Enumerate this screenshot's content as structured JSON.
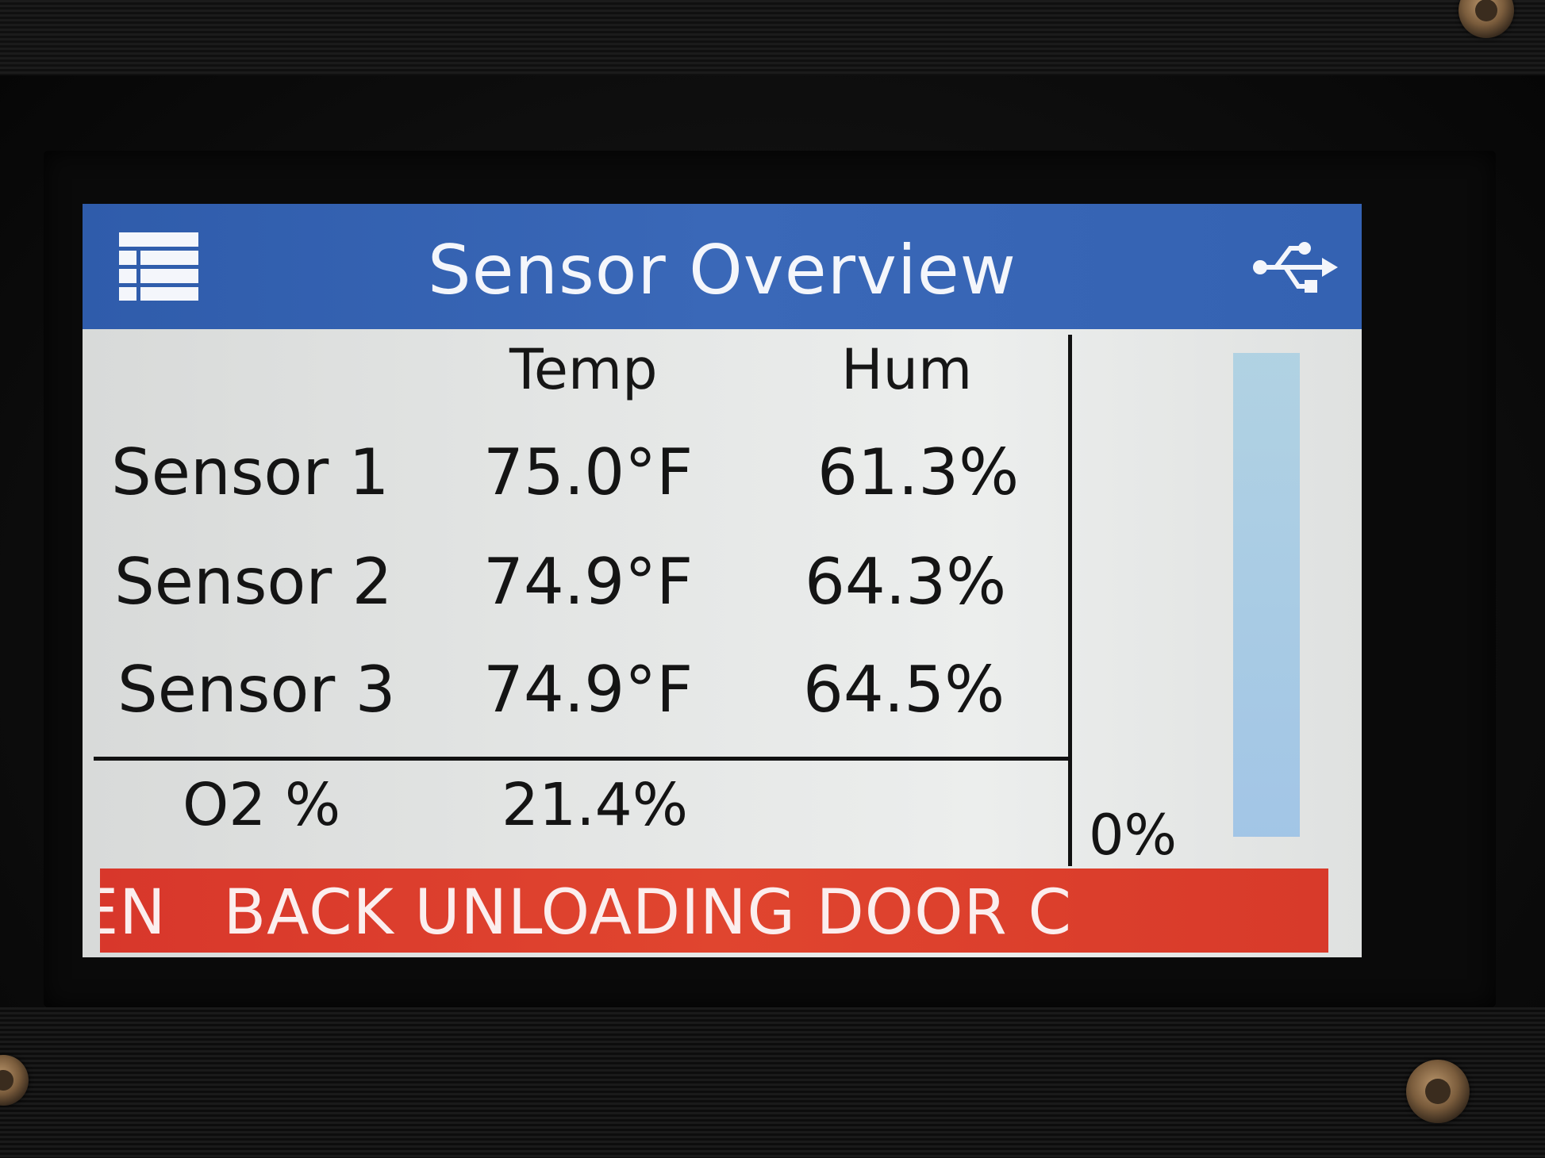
{
  "header": {
    "title": "Sensor Overview",
    "menu_icon": "menu-grid-icon",
    "status_icon": "usb-icon",
    "color": "#3462b2"
  },
  "table": {
    "columns": [
      "Temp",
      "Hum"
    ],
    "rows": [
      {
        "label": "Sensor 1",
        "temp": "75.0°F",
        "hum": "61.3%"
      },
      {
        "label": "Sensor 2",
        "temp": "74.9°F",
        "hum": "64.3%"
      },
      {
        "label": "Sensor 3",
        "temp": "74.9°F",
        "hum": "64.5%"
      }
    ]
  },
  "o2": {
    "label": "O2 %",
    "value": "21.4%"
  },
  "level": {
    "text": "0%",
    "fill_fraction": 0.0,
    "bar_color": "#9ec6e4"
  },
  "alert": {
    "visible_lead": "EN",
    "text": "BACK UNLOADING DOOR C",
    "color": "#e0452f"
  }
}
